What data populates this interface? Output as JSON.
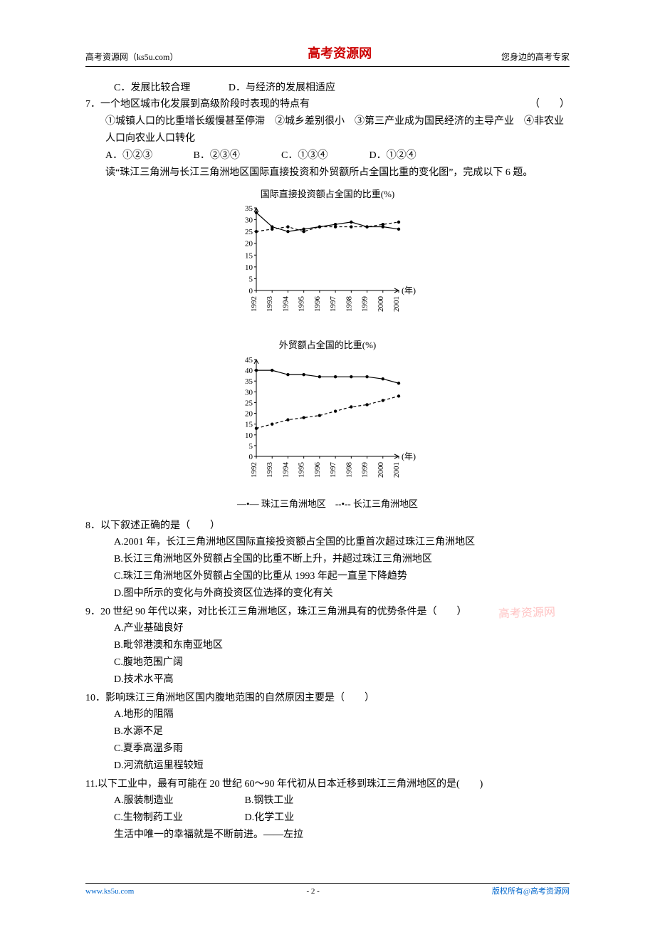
{
  "header": {
    "left": "高考资源网（ks5u.com）",
    "center": "高考资源网",
    "right": "您身边的高考专家"
  },
  "q6_tail": {
    "C": "C．发展比较合理",
    "D": "D．与经济的发展相适应"
  },
  "q7": {
    "stem": "7．一个地区城市化发展到高级阶段时表现的特点有",
    "paren": "（　　）",
    "items": "①城镇人口的比重增长缓慢甚至停滞　②城乡差别很小　③第三产业成为国民经济的主导产业　④非农业人口向农业人口转化",
    "A": "A．①②③",
    "B": "B．②③④",
    "C": "C．①③④",
    "D": "D．①②④",
    "lead": "读“珠江三角洲与长江三角洲地区国际直接投资和外贸额所占全国比重的变化图”，完成以下 6 题。"
  },
  "chart_data": [
    {
      "type": "line",
      "title": "国际直接投资额占全国的比重(%)",
      "xlabel": "(年)",
      "x": [
        1992,
        1993,
        1994,
        1995,
        1996,
        1997,
        1998,
        1999,
        2000,
        2001
      ],
      "ylim": [
        0,
        35
      ],
      "yticks": [
        0,
        5,
        10,
        15,
        20,
        25,
        30,
        35
      ],
      "series": [
        {
          "name": "珠江三角洲地区",
          "style": "solid",
          "values": [
            33,
            27,
            25,
            26,
            27,
            28,
            29,
            27,
            27,
            26
          ]
        },
        {
          "name": "长江三角洲地区",
          "style": "dashed",
          "values": [
            25,
            26,
            27,
            25,
            27,
            27,
            27,
            27,
            28,
            29
          ]
        }
      ]
    },
    {
      "type": "line",
      "title": "外贸额占全国的比重(%)",
      "xlabel": "(年)",
      "x": [
        1992,
        1993,
        1994,
        1995,
        1996,
        1997,
        1998,
        1999,
        2000,
        2001
      ],
      "ylim": [
        0,
        45
      ],
      "yticks": [
        0,
        5,
        10,
        15,
        20,
        25,
        30,
        35,
        40,
        45
      ],
      "series": [
        {
          "name": "珠江三角洲地区",
          "style": "solid",
          "values": [
            40,
            40,
            38,
            38,
            37,
            37,
            37,
            37,
            36,
            34
          ]
        },
        {
          "name": "长江三角洲地区",
          "style": "dashed",
          "values": [
            13,
            15,
            17,
            18,
            19,
            21,
            23,
            24,
            26,
            28
          ]
        }
      ]
    }
  ],
  "legend": {
    "solid": "—•— 珠江三角洲地区",
    "dashed": "--•-- 长江三角洲地区"
  },
  "q8": {
    "stem": "8．以下叙述正确的是（　　）",
    "A": "A.2001 年，长江三角洲地区国际直接投资额占全国的比重首次超过珠江三角洲地区",
    "B": "B.长江三角洲地区外贸额占全国的比重不断上升，并超过珠江三角洲地区",
    "C": "C.珠江三角洲地区外贸额占全国的比重从 1993 年起一直呈下降趋势",
    "D": "D.图中所示的变化与外商投资区位选择的变化有关"
  },
  "q9": {
    "stem": "9．20 世纪 90 年代以来，对比长江三角洲地区，珠江三角洲具有的优势条件是（　　）",
    "A": "A.产业基础良好",
    "B": "B.毗邻港澳和东南亚地区",
    "C": "C.腹地范围广阔",
    "D": "D.技术水平高"
  },
  "q10": {
    "stem": "10．影响珠江三角洲地区国内腹地范围的自然原因主要是（　　）",
    "A": "A.地形的阻隔",
    "B": "B.水源不足",
    "C": "C.夏季高温多雨",
    "D": "D.河流航运里程较短"
  },
  "q11": {
    "stem": "11.以下工业中，最有可能在 20 世纪 60～90 年代初从日本迁移到珠江三角洲地区的是(　　)",
    "A": "A.服装制造业",
    "B": "B.钢铁工业",
    "C": "C.生物制药工业",
    "D": "D.化学工业",
    "quote": "生活中唯一的幸福就是不断前进。——左拉"
  },
  "watermark": "高考资源网",
  "footer": {
    "left": "www.ks5u.com",
    "center": "- 2 -",
    "right": "版权所有@高考资源网"
  }
}
